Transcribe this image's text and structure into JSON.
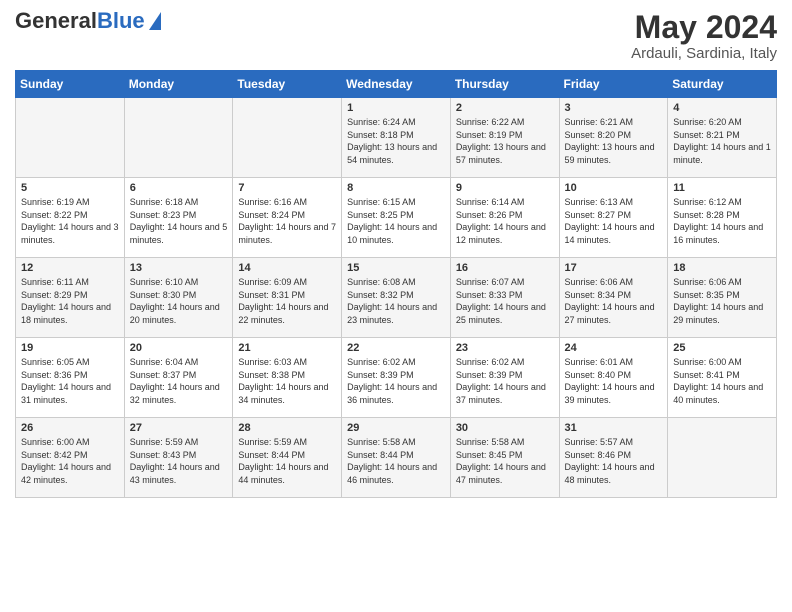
{
  "header": {
    "logo_general": "General",
    "logo_blue": "Blue",
    "main_title": "May 2024",
    "sub_title": "Ardauli, Sardinia, Italy"
  },
  "days_of_week": [
    "Sunday",
    "Monday",
    "Tuesday",
    "Wednesday",
    "Thursday",
    "Friday",
    "Saturday"
  ],
  "weeks": [
    [
      {
        "day": "",
        "info": ""
      },
      {
        "day": "",
        "info": ""
      },
      {
        "day": "",
        "info": ""
      },
      {
        "day": "1",
        "info": "Sunrise: 6:24 AM\nSunset: 8:18 PM\nDaylight: 13 hours and 54 minutes."
      },
      {
        "day": "2",
        "info": "Sunrise: 6:22 AM\nSunset: 8:19 PM\nDaylight: 13 hours and 57 minutes."
      },
      {
        "day": "3",
        "info": "Sunrise: 6:21 AM\nSunset: 8:20 PM\nDaylight: 13 hours and 59 minutes."
      },
      {
        "day": "4",
        "info": "Sunrise: 6:20 AM\nSunset: 8:21 PM\nDaylight: 14 hours and 1 minute."
      }
    ],
    [
      {
        "day": "5",
        "info": "Sunrise: 6:19 AM\nSunset: 8:22 PM\nDaylight: 14 hours and 3 minutes."
      },
      {
        "day": "6",
        "info": "Sunrise: 6:18 AM\nSunset: 8:23 PM\nDaylight: 14 hours and 5 minutes."
      },
      {
        "day": "7",
        "info": "Sunrise: 6:16 AM\nSunset: 8:24 PM\nDaylight: 14 hours and 7 minutes."
      },
      {
        "day": "8",
        "info": "Sunrise: 6:15 AM\nSunset: 8:25 PM\nDaylight: 14 hours and 10 minutes."
      },
      {
        "day": "9",
        "info": "Sunrise: 6:14 AM\nSunset: 8:26 PM\nDaylight: 14 hours and 12 minutes."
      },
      {
        "day": "10",
        "info": "Sunrise: 6:13 AM\nSunset: 8:27 PM\nDaylight: 14 hours and 14 minutes."
      },
      {
        "day": "11",
        "info": "Sunrise: 6:12 AM\nSunset: 8:28 PM\nDaylight: 14 hours and 16 minutes."
      }
    ],
    [
      {
        "day": "12",
        "info": "Sunrise: 6:11 AM\nSunset: 8:29 PM\nDaylight: 14 hours and 18 minutes."
      },
      {
        "day": "13",
        "info": "Sunrise: 6:10 AM\nSunset: 8:30 PM\nDaylight: 14 hours and 20 minutes."
      },
      {
        "day": "14",
        "info": "Sunrise: 6:09 AM\nSunset: 8:31 PM\nDaylight: 14 hours and 22 minutes."
      },
      {
        "day": "15",
        "info": "Sunrise: 6:08 AM\nSunset: 8:32 PM\nDaylight: 14 hours and 23 minutes."
      },
      {
        "day": "16",
        "info": "Sunrise: 6:07 AM\nSunset: 8:33 PM\nDaylight: 14 hours and 25 minutes."
      },
      {
        "day": "17",
        "info": "Sunrise: 6:06 AM\nSunset: 8:34 PM\nDaylight: 14 hours and 27 minutes."
      },
      {
        "day": "18",
        "info": "Sunrise: 6:06 AM\nSunset: 8:35 PM\nDaylight: 14 hours and 29 minutes."
      }
    ],
    [
      {
        "day": "19",
        "info": "Sunrise: 6:05 AM\nSunset: 8:36 PM\nDaylight: 14 hours and 31 minutes."
      },
      {
        "day": "20",
        "info": "Sunrise: 6:04 AM\nSunset: 8:37 PM\nDaylight: 14 hours and 32 minutes."
      },
      {
        "day": "21",
        "info": "Sunrise: 6:03 AM\nSunset: 8:38 PM\nDaylight: 14 hours and 34 minutes."
      },
      {
        "day": "22",
        "info": "Sunrise: 6:02 AM\nSunset: 8:39 PM\nDaylight: 14 hours and 36 minutes."
      },
      {
        "day": "23",
        "info": "Sunrise: 6:02 AM\nSunset: 8:39 PM\nDaylight: 14 hours and 37 minutes."
      },
      {
        "day": "24",
        "info": "Sunrise: 6:01 AM\nSunset: 8:40 PM\nDaylight: 14 hours and 39 minutes."
      },
      {
        "day": "25",
        "info": "Sunrise: 6:00 AM\nSunset: 8:41 PM\nDaylight: 14 hours and 40 minutes."
      }
    ],
    [
      {
        "day": "26",
        "info": "Sunrise: 6:00 AM\nSunset: 8:42 PM\nDaylight: 14 hours and 42 minutes."
      },
      {
        "day": "27",
        "info": "Sunrise: 5:59 AM\nSunset: 8:43 PM\nDaylight: 14 hours and 43 minutes."
      },
      {
        "day": "28",
        "info": "Sunrise: 5:59 AM\nSunset: 8:44 PM\nDaylight: 14 hours and 44 minutes."
      },
      {
        "day": "29",
        "info": "Sunrise: 5:58 AM\nSunset: 8:44 PM\nDaylight: 14 hours and 46 minutes."
      },
      {
        "day": "30",
        "info": "Sunrise: 5:58 AM\nSunset: 8:45 PM\nDaylight: 14 hours and 47 minutes."
      },
      {
        "day": "31",
        "info": "Sunrise: 5:57 AM\nSunset: 8:46 PM\nDaylight: 14 hours and 48 minutes."
      },
      {
        "day": "",
        "info": ""
      }
    ]
  ]
}
